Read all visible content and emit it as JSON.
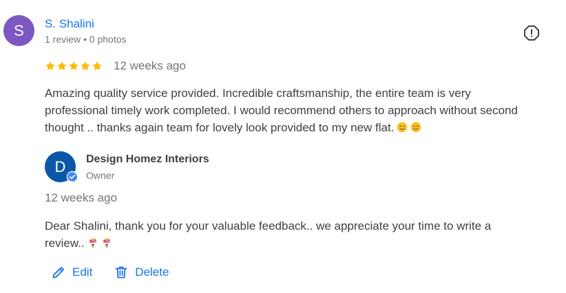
{
  "reviewer": {
    "initial": "S",
    "name": "S. Shalini",
    "meta": "1 review • 0 photos",
    "avatar_color": "#7e57c2"
  },
  "review": {
    "rating": 5,
    "rating_max": 5,
    "age": "12 weeks ago",
    "text": "Amazing quality service provided. Incredible craftsmanship, the entire team is very professional timely work completed. I would recommend others to approach without second thought .. thanks again team for lovely look provided to my new flat.",
    "emojis": [
      "smiling-face-emoji",
      "smiling-face-emoji"
    ],
    "star_color": "#fbbc04"
  },
  "report": {
    "icon": "report-flag-icon"
  },
  "owner_reply": {
    "initial": "D",
    "name": "Design Homez Interiors",
    "role": "Owner",
    "avatar_color": "#0b57a7",
    "age": "12 weeks ago",
    "text": "Dear Shalini, thank you for your valuable feedback.. we appreciate your time to write a review..",
    "emojis": [
      "bouquet-emoji",
      "bouquet-emoji"
    ]
  },
  "actions": {
    "edit_label": "Edit",
    "delete_label": "Delete",
    "accent": "#1a73e8"
  }
}
